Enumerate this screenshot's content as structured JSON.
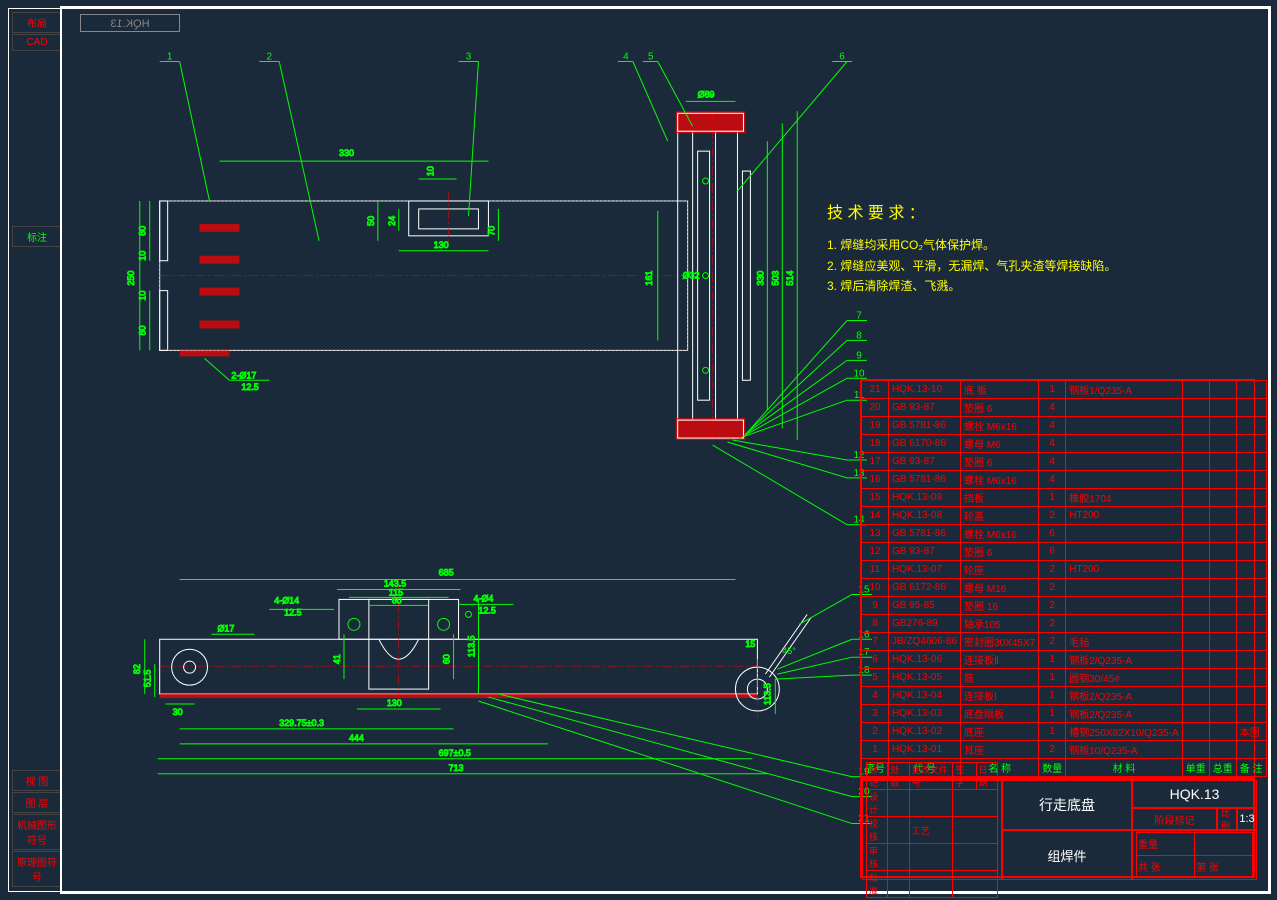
{
  "drawing_code_mirror": "HQK.13",
  "side_tabs_top": [
    "布局",
    "CAD"
  ],
  "side_tabs_mid": [
    "标注"
  ],
  "side_tabs_low": [
    "视 图",
    "图 层",
    "机械图形符号",
    "原理图符号"
  ],
  "req": {
    "title": "技 术 要 求 ：",
    "lines": [
      "1. 焊缝均采用CO₂气体保护焊。",
      "2. 焊缝应美观、平滑，无漏焊、气孔夹渣等焊接缺陷。",
      "3. 焊后清除焊渣、飞溅。"
    ]
  },
  "dims": {
    "d_330": "330",
    "d_130": "130",
    "d_50": "50",
    "d_24": "24",
    "d_10": "10",
    "d_70": "70",
    "d_80a": "80",
    "d_10a": "10",
    "d_10b": "10",
    "d_80b": "80",
    "d_250": "250",
    "phi17": "2-Ø17",
    "r125a": "12.5",
    "phi89": "Ø89",
    "d_161": "161",
    "phi32": "Ø32",
    "d_330b": "330",
    "d_503": "503",
    "d_514": "514",
    "d_685": "685",
    "d_1435": "143.5",
    "d_115": "115",
    "d_60": "60",
    "phi14": "4-Ø14",
    "r125b": "12.5",
    "phi4": "4-Ø4",
    "r125c": "12.5",
    "phi17b": "Ø17",
    "d_82": "82",
    "d_515": "51.5",
    "d_30": "30",
    "d_60b": "60",
    "d_41": "41",
    "d_1135": "113.5",
    "d_130b": "130",
    "d_32975": "329.75±0.3",
    "d_444": "444",
    "d_697": "697±0.5",
    "d_713": "713",
    "d_15": "15",
    "d_1135b": "113.5",
    "a_45": "45°"
  },
  "balloons_top": [
    "1",
    "2",
    "3",
    "4",
    "5",
    "6"
  ],
  "balloons_right": [
    "7",
    "8",
    "9",
    "10",
    "11",
    "12",
    "13",
    "14"
  ],
  "balloons_low": [
    "15",
    "16",
    "17",
    "18",
    "19",
    "20",
    "21"
  ],
  "bom_headers": [
    "序号",
    "代 号",
    "名 称",
    "数量",
    "材 料",
    "单重",
    "总重",
    "备 注"
  ],
  "bom": [
    {
      "n": "21",
      "code": "HQK.13-10",
      "name": "底 板",
      "q": "1",
      "mat": "钢板1/Q235-A",
      "w1": "",
      "w2": "",
      "note": ""
    },
    {
      "n": "20",
      "code": "GB 93-87",
      "name": "垫圈 6",
      "q": "4",
      "mat": "",
      "w1": "",
      "w2": "",
      "note": ""
    },
    {
      "n": "19",
      "code": "GB 5781-86",
      "name": "螺栓 M6x16",
      "q": "4",
      "mat": "",
      "w1": "",
      "w2": "",
      "note": ""
    },
    {
      "n": "18",
      "code": "GB 6170-86",
      "name": "螺母 M6",
      "q": "4",
      "mat": "",
      "w1": "",
      "w2": "",
      "note": ""
    },
    {
      "n": "17",
      "code": "GB 93-87",
      "name": "垫圈 6",
      "q": "4",
      "mat": "",
      "w1": "",
      "w2": "",
      "note": ""
    },
    {
      "n": "16",
      "code": "GB 5781-86",
      "name": "螺栓 M6x16",
      "q": "4",
      "mat": "",
      "w1": "",
      "w2": "",
      "note": ""
    },
    {
      "n": "15",
      "code": "HQK.13-09",
      "name": "挡板",
      "q": "1",
      "mat": "橡胶1704",
      "w1": "",
      "w2": "",
      "note": ""
    },
    {
      "n": "14",
      "code": "HQK.13-08",
      "name": "轮盖",
      "q": "2",
      "mat": "HT200",
      "w1": "",
      "w2": "",
      "note": ""
    },
    {
      "n": "13",
      "code": "GB 5781-86",
      "name": "螺栓 M6x16",
      "q": "6",
      "mat": "",
      "w1": "",
      "w2": "",
      "note": ""
    },
    {
      "n": "12",
      "code": "GB 93-87",
      "name": "垫圈 6",
      "q": "6",
      "mat": "",
      "w1": "",
      "w2": "",
      "note": ""
    },
    {
      "n": "11",
      "code": "HQK.13-07",
      "name": "轮座",
      "q": "2",
      "mat": "HT200",
      "w1": "",
      "w2": "",
      "note": ""
    },
    {
      "n": "10",
      "code": "GB 6172-86",
      "name": "螺母 M16",
      "q": "2",
      "mat": "",
      "w1": "",
      "w2": "",
      "note": ""
    },
    {
      "n": "9",
      "code": "GB 95-85",
      "name": "垫圈 16",
      "q": "2",
      "mat": "",
      "w1": "",
      "w2": "",
      "note": ""
    },
    {
      "n": "8",
      "code": "GB276-89",
      "name": "轴承105",
      "q": "2",
      "mat": "",
      "w1": "",
      "w2": "",
      "note": ""
    },
    {
      "n": "7",
      "code": "JB/ZQ4606-86",
      "name": "密封圈30X45X7",
      "q": "2",
      "mat": "毛毡",
      "w1": "",
      "w2": "",
      "note": ""
    },
    {
      "n": "6",
      "code": "HQK.13-06",
      "name": "连接板Ⅱ",
      "q": "1",
      "mat": "钢板2/Q235-A",
      "w1": "",
      "w2": "",
      "note": ""
    },
    {
      "n": "5",
      "code": "HQK.13-05",
      "name": "筋",
      "q": "1",
      "mat": "圆钢30/45#",
      "w1": "",
      "w2": "",
      "note": ""
    },
    {
      "n": "4",
      "code": "HQK.13-04",
      "name": "连接板Ⅰ",
      "q": "1",
      "mat": "钢板2/Q235-A",
      "w1": "",
      "w2": "",
      "note": ""
    },
    {
      "n": "3",
      "code": "HQK.13-03",
      "name": "底盘隔板",
      "q": "1",
      "mat": "钢板2/Q235-A",
      "w1": "",
      "w2": "",
      "note": ""
    },
    {
      "n": "2",
      "code": "HQK.13-02",
      "name": "底座",
      "q": "1",
      "mat": "槽钢250X82X10/Q235-A",
      "w1": "",
      "w2": "",
      "note": "本图"
    },
    {
      "n": "1",
      "code": "HQK.13-01",
      "name": "耳座",
      "q": "2",
      "mat": "钢板10/Q235-A",
      "w1": "",
      "w2": "",
      "note": ""
    }
  ],
  "titleblock": {
    "name": "行走底盘",
    "type": "组焊件",
    "code": "HQK.13",
    "scale_label": "比例",
    "scale": "1:3",
    "sig_rows": [
      "设计",
      "校核",
      "工艺",
      "审核",
      "批准"
    ],
    "sig_cols": [
      "签名",
      "日期"
    ],
    "another": [
      "标记",
      "处数",
      "更改文件号",
      "签 字",
      "日期"
    ],
    "misc": [
      "重量",
      "共 张",
      "第 张",
      "阶段标记"
    ]
  }
}
